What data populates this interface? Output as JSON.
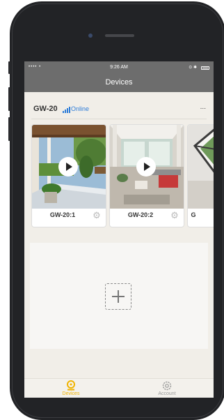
{
  "status_bar": {
    "signal": "•••• •",
    "time": "9:26 AM",
    "right_icons": "⊙ ✱"
  },
  "header": {
    "title": "Devices"
  },
  "gateway": {
    "name": "GW-20",
    "status": "Online",
    "more": "..."
  },
  "cameras": [
    {
      "label": "GW-20:1"
    },
    {
      "label": "GW-20:2"
    },
    {
      "label": "G"
    }
  ],
  "tabs": [
    {
      "label": "Devices",
      "icon": "camera-icon",
      "color": "#f0b400"
    },
    {
      "label": "Account",
      "icon": "gear-icon",
      "color": "#9a9a9a"
    }
  ],
  "colors": {
    "accent": "#f0b400",
    "online": "#2f7dd8",
    "header": "#6d6d6d"
  }
}
